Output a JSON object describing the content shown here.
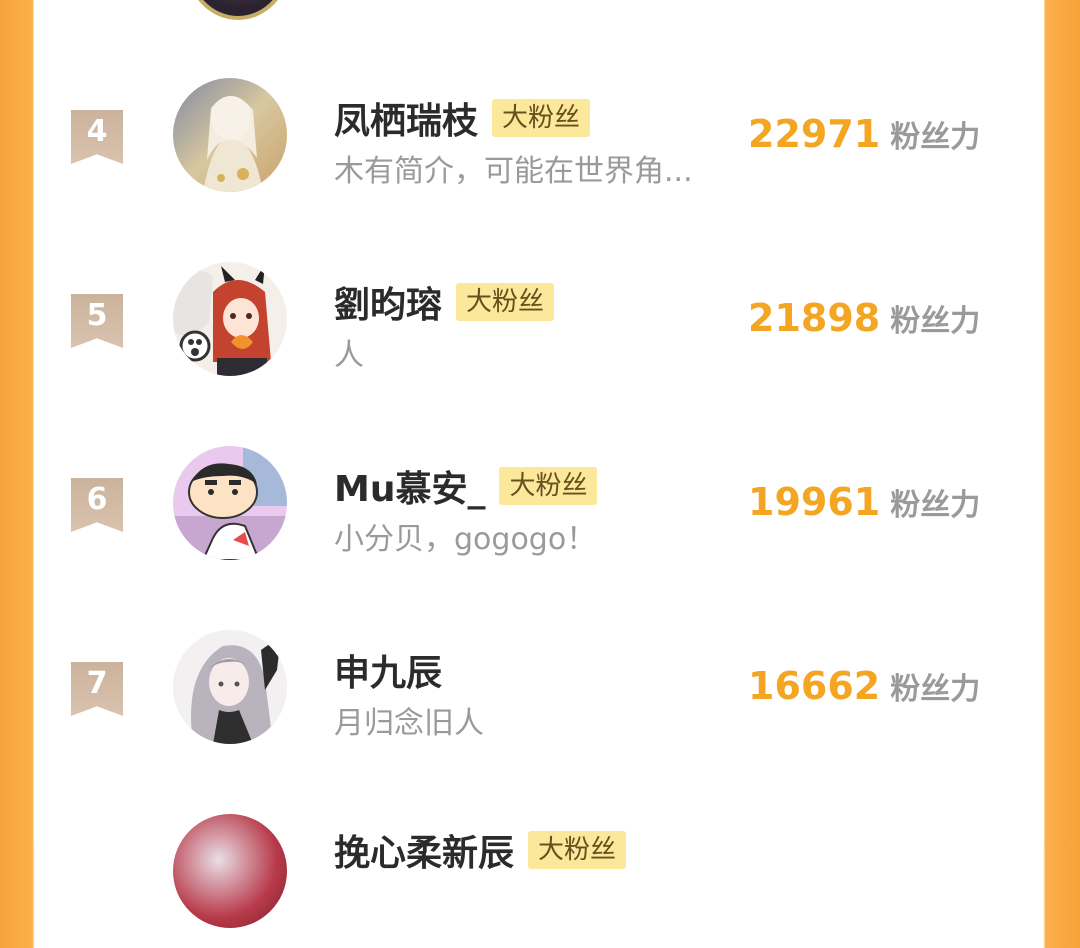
{
  "colors": {
    "accent_orange": "#f4a623",
    "side_orange": "#f7a33a",
    "badge_bg": "#fbe89a",
    "rank_ribbon": "#cbb29c",
    "name_text": "#2b2b2b",
    "muted_text": "#9a9a9a"
  },
  "score_unit": "粉丝力",
  "fans": [
    {
      "rank": "4",
      "name": "凤栖瑞枝",
      "badge": "大粉丝",
      "intro": "木有简介，可能在世界角...",
      "score": "22971",
      "avatar_icon": "avatar-white-haired-figure"
    },
    {
      "rank": "5",
      "name": "劉昀瑢",
      "badge": "大粉丝",
      "intro": "人",
      "score": "21898",
      "avatar_icon": "avatar-red-haired-girl"
    },
    {
      "rank": "6",
      "name": "Mu慕安_",
      "badge": "大粉丝",
      "intro": "小分贝，gogogo！",
      "score": "19961",
      "avatar_icon": "avatar-cartoon-boy"
    },
    {
      "rank": "7",
      "name": "申九辰",
      "badge": "",
      "intro": "月归念旧人",
      "score": "16662",
      "avatar_icon": "avatar-gray-haired-girl"
    }
  ],
  "partial_bottom": {
    "name": "挽心柔新辰",
    "badge": "大粉丝"
  }
}
